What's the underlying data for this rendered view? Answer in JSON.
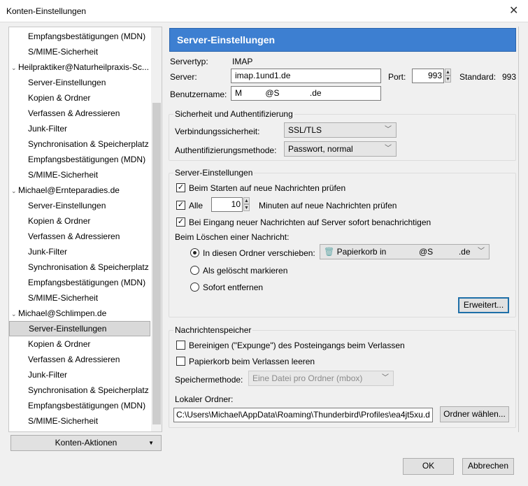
{
  "window": {
    "title": "Konten-Einstellungen",
    "close": "✕"
  },
  "tree": {
    "items": [
      {
        "label": "Empfangsbestätigungen (MDN)",
        "type": "sub"
      },
      {
        "label": "S/MIME-Sicherheit",
        "type": "sub"
      },
      {
        "label": "Heilpraktiker@Naturheilpraxis-Sc...",
        "type": "acc"
      },
      {
        "label": "Server-Einstellungen",
        "type": "sub"
      },
      {
        "label": "Kopien & Ordner",
        "type": "sub"
      },
      {
        "label": "Verfassen & Adressieren",
        "type": "sub"
      },
      {
        "label": "Junk-Filter",
        "type": "sub"
      },
      {
        "label": "Synchronisation & Speicherplatz",
        "type": "sub"
      },
      {
        "label": "Empfangsbestätigungen (MDN)",
        "type": "sub"
      },
      {
        "label": "S/MIME-Sicherheit",
        "type": "sub"
      },
      {
        "label": "Michael@Ernteparadies.de",
        "type": "acc"
      },
      {
        "label": "Server-Einstellungen",
        "type": "sub"
      },
      {
        "label": "Kopien & Ordner",
        "type": "sub"
      },
      {
        "label": "Verfassen & Adressieren",
        "type": "sub"
      },
      {
        "label": "Junk-Filter",
        "type": "sub"
      },
      {
        "label": "Synchronisation & Speicherplatz",
        "type": "sub"
      },
      {
        "label": "Empfangsbestätigungen (MDN)",
        "type": "sub"
      },
      {
        "label": "S/MIME-Sicherheit",
        "type": "sub"
      },
      {
        "label": "Michael@Schlimpen.de",
        "type": "acc"
      },
      {
        "label": "Server-Einstellungen",
        "type": "sub",
        "selected": true
      },
      {
        "label": "Kopien & Ordner",
        "type": "sub"
      },
      {
        "label": "Verfassen & Adressieren",
        "type": "sub"
      },
      {
        "label": "Junk-Filter",
        "type": "sub"
      },
      {
        "label": "Synchronisation & Speicherplatz",
        "type": "sub"
      },
      {
        "label": "Empfangsbestätigungen (MDN)",
        "type": "sub"
      },
      {
        "label": "S/MIME-Sicherheit",
        "type": "sub"
      }
    ]
  },
  "account_actions": "Konten-Aktionen",
  "header": {
    "title": "Server-Einstellungen",
    "color": "#3d7fd1"
  },
  "server": {
    "type_label": "Servertyp:",
    "type_value": "IMAP",
    "server_label": "Server:",
    "server_value": "imap.1und1.de",
    "port_label": "Port:",
    "port_value": "993",
    "standard_label": "Standard:",
    "standard_value": "993",
    "user_label": "Benutzername:",
    "user_value": "M          @S             .de"
  },
  "security": {
    "legend": "Sicherheit und Authentifizierung",
    "conn_label": "Verbindungssicherheit:",
    "conn_value": "SSL/TLS",
    "auth_label": "Authentifizierungsmethode:",
    "auth_value": "Passwort, normal"
  },
  "settings": {
    "legend": "Server-Einstellungen",
    "check_start": "Beim Starten auf neue Nachrichten prüfen",
    "check_every": "Alle",
    "minutes_value": "10",
    "minutes_label": "Minuten auf neue Nachrichten prüfen",
    "notify": "Bei Eingang neuer Nachrichten auf Server sofort benachrichtigen",
    "delete_label": "Beim Löschen einer Nachricht:",
    "move": "In diesen Ordner verschieben:",
    "move_folder": "Papierkorb in              @S           .de",
    "mark": "Als gelöscht markieren",
    "remove": "Sofort entfernen",
    "advanced": "Erweitert..."
  },
  "storage": {
    "legend": "Nachrichtenspeicher",
    "expunge": "Bereinigen (\"Expunge\") des Posteingangs beim Verlassen",
    "empty_trash": "Papierkorb beim Verlassen leeren",
    "method_label": "Speichermethode:",
    "method_value": "Eine Datei pro Ordner (mbox)",
    "local_label": "Lokaler Ordner:",
    "local_value": "C:\\Users\\Michael\\AppData\\Roaming\\Thunderbird\\Profiles\\ea4jt5xu.d",
    "choose": "Ordner wählen..."
  },
  "footer": {
    "ok": "OK",
    "cancel": "Abbrechen"
  }
}
